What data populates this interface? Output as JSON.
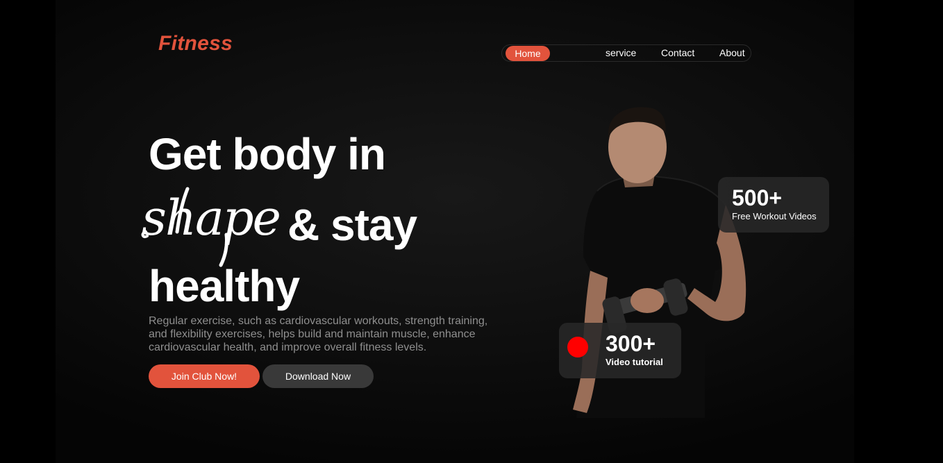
{
  "brand": {
    "logo_text": "Fitness",
    "accent_color": "#e2533c"
  },
  "nav": {
    "items": [
      {
        "label": "Home",
        "active": true
      },
      {
        "label": "service",
        "active": false
      },
      {
        "label": "Contact",
        "active": false
      },
      {
        "label": "About",
        "active": false
      }
    ]
  },
  "hero": {
    "line1": "Get body in",
    "script_word": "shape",
    "line2": "& stay",
    "line3": "healthy",
    "description": "Regular exercise, such as cardiovascular workouts, strength training, and flexibility exercises, helps build and maintain muscle, enhance cardiovascular health, and improve overall fitness levels.",
    "primary_button": "Join Club Now!",
    "secondary_button": "Download Now"
  },
  "stats": {
    "videos": {
      "value": "500+",
      "label": "Free Workout Videos"
    },
    "tutorials": {
      "value": "300+",
      "label": "Video tutorial",
      "dot_color": "#ff0000"
    }
  }
}
